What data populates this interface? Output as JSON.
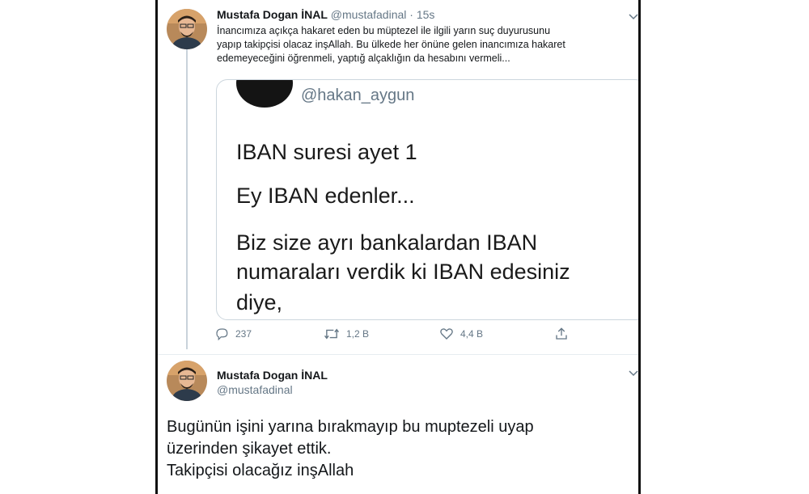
{
  "tweet1": {
    "author_name": "Mustafa Dogan İNAL",
    "handle": "@mustafadinal",
    "separator": "·",
    "time": "15s",
    "text_lines": [
      "İnancımıza açıkça hakaret eden bu müptezel ile ilgili yarın suç duyurusunu",
      "yapıp takipçisi olacaz inşAllah. Bu ülkede her önüne gelen inancımıza hakaret",
      "edemeyeceğini öğrenmeli, yaptığ alçaklığın da hesabını vermeli..."
    ]
  },
  "quoted_tweet": {
    "handle": "@hakan_aygun",
    "lines": [
      "IBAN suresi ayet 1",
      "Ey IBAN edenler...",
      "Biz size ayrı bankalardan IBAN",
      "numaraları verdik ki IBAN edesiniz",
      "diye,"
    ]
  },
  "actions": {
    "reply_count": "237",
    "retweet_count": "1,2 B",
    "like_count": "4,4 B",
    "icons": [
      "reply-icon",
      "retweet-icon",
      "like-icon",
      "share-icon"
    ]
  },
  "tweet2": {
    "author_name": "Mustafa Dogan İNAL",
    "handle": "@mustafadinal",
    "text_lines": [
      "Bugünün işini yarına bırakmayıp bu muptezeli uyap",
      "üzerinden şikayet ettik.",
      "Takipçisi olacağız inşAllah"
    ]
  },
  "colors": {
    "text": "#14171a",
    "muted": "#657786",
    "border": "#ccd6dd",
    "thread_line": "#c9d3db"
  }
}
